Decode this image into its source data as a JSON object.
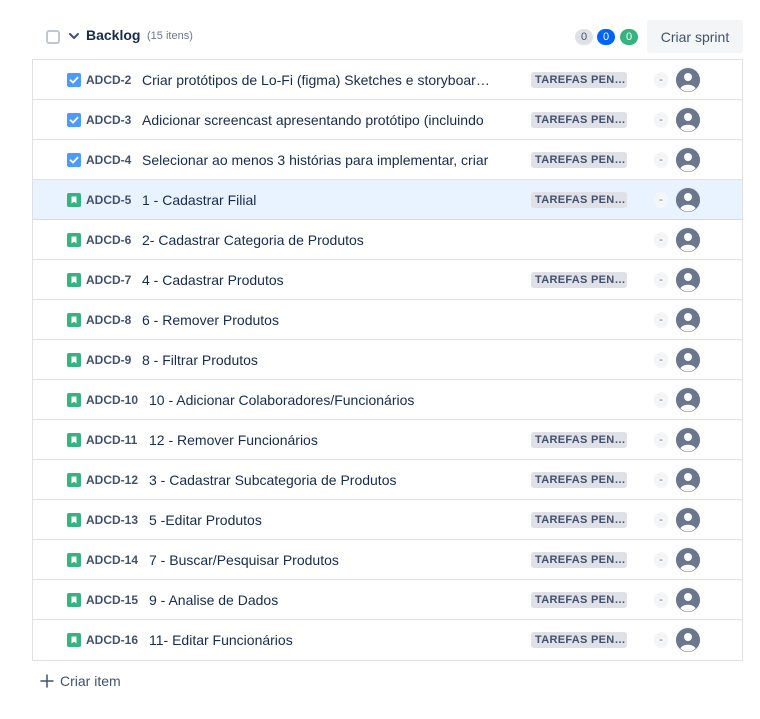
{
  "backlog": {
    "title": "Backlog",
    "count_text": "(15 itens)",
    "badges": {
      "todo": "0",
      "in_progress": "0",
      "done": "0"
    },
    "create_sprint_label": "Criar sprint",
    "create_item_label": "Criar item"
  },
  "colors": {
    "task": "#4c9aff",
    "story": "#36b37e",
    "selected_row": "#e9f2ff"
  },
  "items": [
    {
      "type": "task",
      "type_icon": "checkbox-task-icon",
      "key": "ADCD-2",
      "summary": "Criar protótipos de Lo-Fi (figma) Sketches e storyboards",
      "status": "TAREFAS PENDENTES",
      "estimate": "-"
    },
    {
      "type": "task",
      "type_icon": "checkbox-task-icon",
      "key": "ADCD-3",
      "summary": "Adicionar screencast apresentando protótipo (incluindo",
      "status": "TAREFAS PENDENTES",
      "estimate": "-"
    },
    {
      "type": "task",
      "type_icon": "checkbox-task-icon",
      "key": "ADCD-4",
      "summary": "Selecionar ao menos 3 histórias para implementar, criar",
      "status": "TAREFAS PENDENTES",
      "estimate": "-"
    },
    {
      "type": "story",
      "type_icon": "bookmark-story-icon",
      "key": "ADCD-5",
      "summary": "1 - Cadastrar Filial",
      "status": "TAREFAS PENDENTES",
      "estimate": "-",
      "selected": true
    },
    {
      "type": "story",
      "type_icon": "bookmark-story-icon",
      "key": "ADCD-6",
      "summary": "2- Cadastrar Categoria de Produtos",
      "status": "",
      "estimate": "-"
    },
    {
      "type": "story",
      "type_icon": "bookmark-story-icon",
      "key": "ADCD-7",
      "summary": "4 - Cadastrar Produtos",
      "status": "TAREFAS PENDENTES",
      "estimate": "-"
    },
    {
      "type": "story",
      "type_icon": "bookmark-story-icon",
      "key": "ADCD-8",
      "summary": "6 - Remover Produtos",
      "status": "",
      "estimate": "-"
    },
    {
      "type": "story",
      "type_icon": "bookmark-story-icon",
      "key": "ADCD-9",
      "summary": "8 - Filtrar Produtos",
      "status": "",
      "estimate": "-"
    },
    {
      "type": "story",
      "type_icon": "bookmark-story-icon",
      "key": "ADCD-10",
      "summary": "10 - Adicionar Colaboradores/Funcionários",
      "status": "",
      "estimate": "-"
    },
    {
      "type": "story",
      "type_icon": "bookmark-story-icon",
      "key": "ADCD-11",
      "summary": "12 - Remover Funcionários",
      "status": "TAREFAS PENDENTES",
      "estimate": "-"
    },
    {
      "type": "story",
      "type_icon": "bookmark-story-icon",
      "key": "ADCD-12",
      "summary": "3 - Cadastrar Subcategoria de Produtos",
      "status": "TAREFAS PENDENTES",
      "estimate": "-"
    },
    {
      "type": "story",
      "type_icon": "bookmark-story-icon",
      "key": "ADCD-13",
      "summary": "5 -Editar Produtos",
      "status": "TAREFAS PENDENTES",
      "estimate": "-"
    },
    {
      "type": "story",
      "type_icon": "bookmark-story-icon",
      "key": "ADCD-14",
      "summary": "7 - Buscar/Pesquisar Produtos",
      "status": "TAREFAS PENDENTES",
      "estimate": "-"
    },
    {
      "type": "story",
      "type_icon": "bookmark-story-icon",
      "key": "ADCD-15",
      "summary": "9 - Analise de Dados",
      "status": "TAREFAS PENDENTES",
      "estimate": "-"
    },
    {
      "type": "story",
      "type_icon": "bookmark-story-icon",
      "key": "ADCD-16",
      "summary": "11- Editar Funcionários",
      "status": "TAREFAS PENDENTES",
      "estimate": "-"
    }
  ]
}
